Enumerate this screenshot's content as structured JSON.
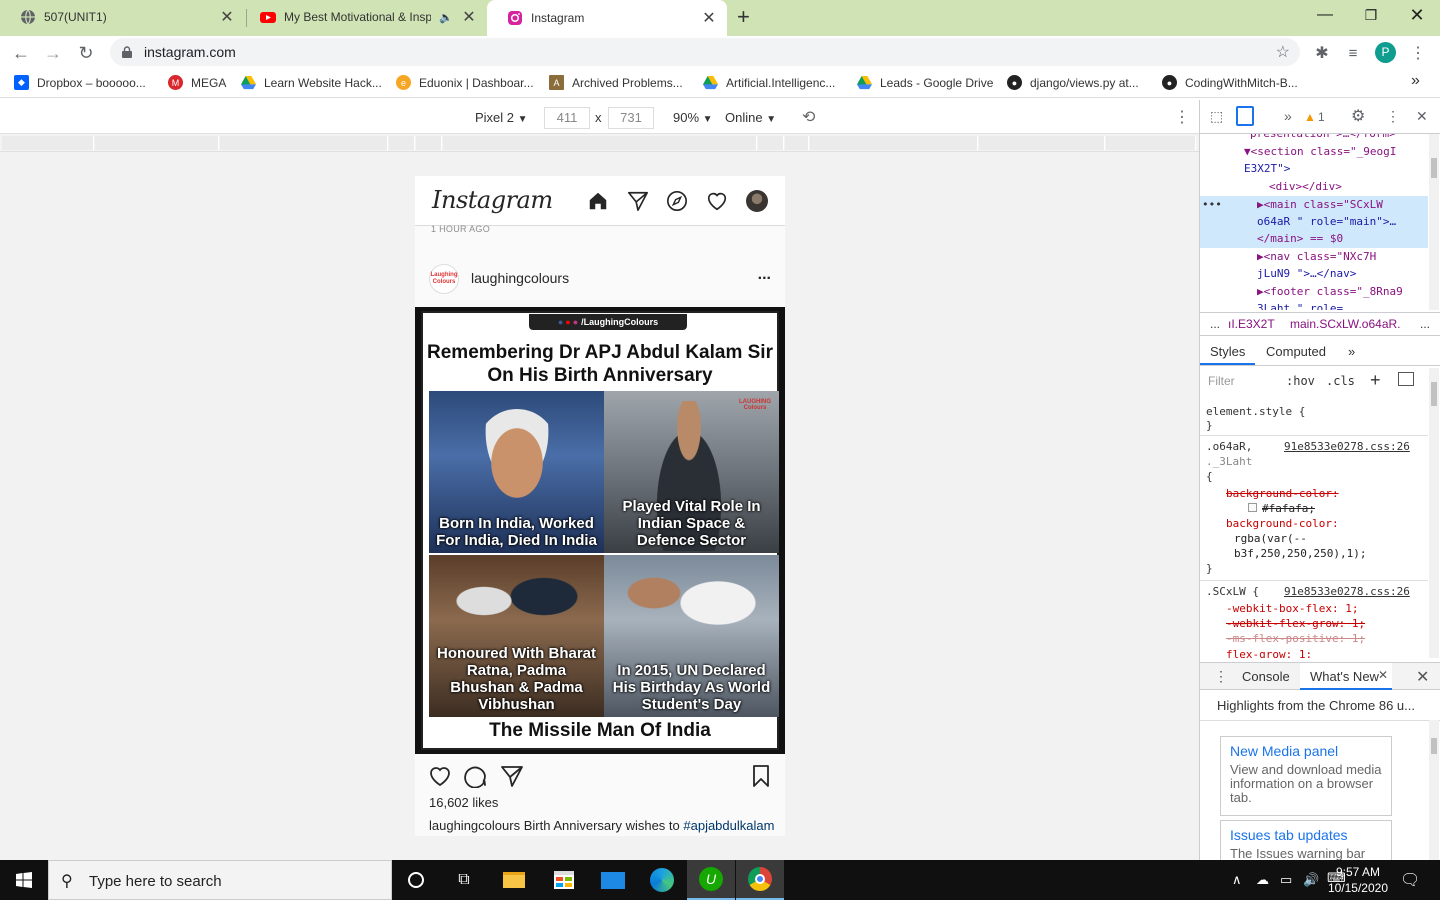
{
  "browser": {
    "tabs": [
      {
        "title": "507(UNIT1)",
        "icon": "globe-icon",
        "active": false
      },
      {
        "title": "My Best Motivational & Insp",
        "icon": "youtube-icon",
        "active": false,
        "muted": true
      },
      {
        "title": "Instagram",
        "icon": "instagram-icon",
        "active": true
      }
    ],
    "new_tab_label": "+",
    "url": "instagram.com",
    "profile_initial": "P",
    "bookmarks": [
      {
        "label": "Dropbox – booooo...",
        "icon": "dropbox-icon"
      },
      {
        "label": "MEGA",
        "icon": "mega-icon"
      },
      {
        "label": "Learn Website Hack...",
        "icon": "drive-icon"
      },
      {
        "label": "Eduonix | Dashboar...",
        "icon": "eduonix-icon"
      },
      {
        "label": "Archived Problems...",
        "icon": "archive-icon"
      },
      {
        "label": "Artificial.Intelligenc...",
        "icon": "drive-icon"
      },
      {
        "label": "Leads - Google Drive",
        "icon": "drive-icon"
      },
      {
        "label": "django/views.py at...",
        "icon": "github-icon"
      },
      {
        "label": "CodingWithMitch-B...",
        "icon": "github-icon"
      }
    ],
    "bookmarks_overflow": "»"
  },
  "device_toolbar": {
    "device": "Pixel 2",
    "width": "411",
    "height": "731",
    "times": "x",
    "zoom": "90%",
    "throttle": "Online"
  },
  "instagram": {
    "logo": "Instagram",
    "timestamp": "1 HOUR AGO",
    "post": {
      "username": "laughingcolours",
      "avatar_text": "Laughing Colours",
      "more": "...",
      "image": {
        "social_handle": "/LaughingColours",
        "title": "Remembering Dr APJ Abdul Kalam Sir On His Birth Anniversary",
        "captions": [
          "Born In India, Worked For India, Died In India",
          "Played Vital Role In Indian Space & Defence Sector",
          "Honoured With Bharat Ratna, Padma Bhushan & Padma Vibhushan",
          "In 2015, UN Declared His Birthday As World Student's Day"
        ],
        "footer": "The Missile Man Of India",
        "watermark": "LAUGHING Colours"
      },
      "likes": "16,602 likes",
      "caption_user": "laughingcolours",
      "caption_text": " Birth Anniversary wishes to ",
      "caption_tag": "#apjabdulkalam"
    }
  },
  "devtools": {
    "warning_count": "1",
    "dom_lines": [
      {
        "indent": 0,
        "text": "presentation >…</form>"
      },
      {
        "indent": 0,
        "text": "▼<section class=\"_9eogI"
      },
      {
        "indent": 1,
        "text": "E3X2T\">"
      },
      {
        "indent": 2,
        "text": "<div></div>"
      },
      {
        "indent": 3,
        "text": "▶<main class=\"SCxLW"
      },
      {
        "indent": 4,
        "text": "o64aR \" role=\"main\">…"
      },
      {
        "indent": 4,
        "text": "</main> == $0"
      },
      {
        "indent": 3,
        "text": "▶<nav class=\"NXc7H"
      },
      {
        "indent": 4,
        "text": "jLuN9  \">…</nav>"
      },
      {
        "indent": 3,
        "text": "▶<footer class=\"_8Rna9"
      },
      {
        "indent": 4,
        "text": "3Laht  \" role="
      }
    ],
    "breadcrumbs": [
      "...",
      "ıI.E3X2T",
      "main.SCxLW.o64aR.",
      "..."
    ],
    "styles_tabs": [
      "Styles",
      "Computed",
      "»"
    ],
    "filter_placeholder": "Filter",
    "hov": ":hov",
    "cls": ".cls",
    "styles": [
      {
        "t": "element.style {",
        "k": "sel"
      },
      {
        "t": "}",
        "k": "sel"
      },
      {
        "t": ".o64aR,",
        "k": "sel",
        "src": "91e8533e0278.css:26"
      },
      {
        "t": "._3Laht",
        "k": "sel"
      },
      {
        "t": "{",
        "k": "sel"
      },
      {
        "t": "background-color:",
        "k": "prop-strike"
      },
      {
        "t": "#fafafa;",
        "k": "val-strike"
      },
      {
        "t": "background-color:",
        "k": "prop"
      },
      {
        "t": "rgba(var(--",
        "k": "val"
      },
      {
        "t": "b3f,250,250,250),1);",
        "k": "val"
      },
      {
        "t": "}",
        "k": "sel"
      },
      {
        "t": ".SCxLW {",
        "k": "sel",
        "src": "91e8533e0278.css:26"
      },
      {
        "t": "-webkit-box-flex: 1;",
        "k": "prop"
      },
      {
        "t": "-webkit-flex-grow: 1;",
        "k": "prop-strike"
      },
      {
        "t": "-ms-flex-positive: 1;",
        "k": "prop-strike"
      },
      {
        "t": "flex-grow: 1;",
        "k": "prop"
      }
    ],
    "drawer_tabs": [
      "Console",
      "What's New"
    ],
    "whats_new_header": "Highlights from the Chrome 86 u...",
    "cards": [
      {
        "title": "New Media panel",
        "desc": "View and download media information on a browser tab."
      },
      {
        "title": "Issues tab updates",
        "desc": "The Issues warning bar"
      }
    ]
  },
  "taskbar": {
    "search_placeholder": "Type here to search",
    "time": "9:57 AM",
    "date": "10/15/2020"
  }
}
